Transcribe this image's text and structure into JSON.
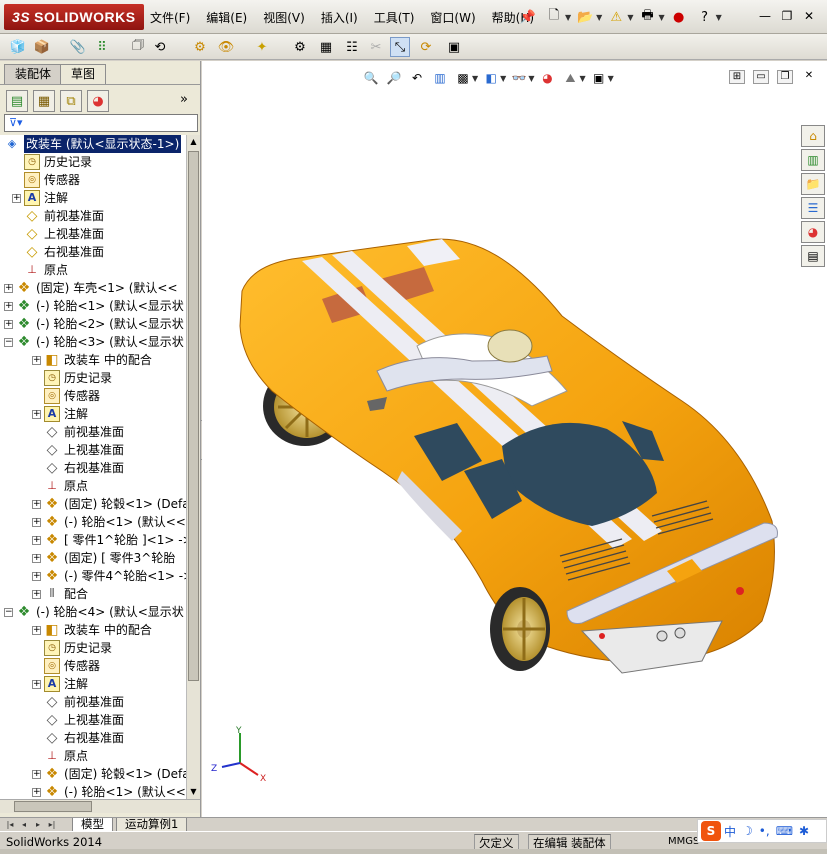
{
  "app": {
    "brand": "SOLIDWORKS",
    "brand_prefix": "3S"
  },
  "menu": [
    "文件(F)",
    "编辑(E)",
    "视图(V)",
    "插入(I)",
    "工具(T)",
    "窗口(W)",
    "帮助(H)"
  ],
  "panel_tabs": {
    "assembly": "装配体",
    "sketch": "草图"
  },
  "filter_icon": "filter-icon",
  "tree": {
    "root": "改装车  (默认<显示状态-1>)",
    "items": [
      {
        "label": "历史记录",
        "icon": "history-icon"
      },
      {
        "label": "传感器",
        "icon": "sensor-icon"
      },
      {
        "label": "注解",
        "icon": "annotation-icon"
      },
      {
        "label": "前视基准面",
        "icon": "plane-icon"
      },
      {
        "label": "上视基准面",
        "icon": "plane-icon"
      },
      {
        "label": "右视基准面",
        "icon": "plane-icon"
      },
      {
        "label": "原点",
        "icon": "origin-icon"
      },
      {
        "label": "(固定) 车壳<1> (默认<<",
        "icon": "component-icon"
      },
      {
        "label": "(-) 轮胎<1> (默认<显示状",
        "icon": "subassembly-icon"
      },
      {
        "label": "(-) 轮胎<2> (默认<显示状",
        "icon": "subassembly-icon"
      },
      {
        "label": "(-) 轮胎<3> (默认<显示状",
        "icon": "subassembly-icon"
      },
      {
        "label": "改装车 中的配合",
        "icon": "mates-icon"
      },
      {
        "label": "历史记录",
        "icon": "history-icon"
      },
      {
        "label": "传感器",
        "icon": "sensor-icon"
      },
      {
        "label": "注解",
        "icon": "annotation-icon"
      },
      {
        "label": "前视基准面",
        "icon": "plane-icon"
      },
      {
        "label": "上视基准面",
        "icon": "plane-icon"
      },
      {
        "label": "右视基准面",
        "icon": "plane-icon"
      },
      {
        "label": "原点",
        "icon": "origin-icon"
      },
      {
        "label": "(固定) 轮毂<1> (Defa",
        "icon": "component-icon"
      },
      {
        "label": "(-) 轮胎<1> (默认<<",
        "icon": "component-icon"
      },
      {
        "label": "[ 零件1^轮胎 ]<1> ->",
        "icon": "component-icon"
      },
      {
        "label": "(固定) [ 零件3^轮胎",
        "icon": "component-icon"
      },
      {
        "label": "(-) 零件4^轮胎<1> ->",
        "icon": "component-icon"
      },
      {
        "label": "配合",
        "icon": "mate-folder-icon"
      },
      {
        "label": "(-) 轮胎<4> (默认<显示状",
        "icon": "subassembly-icon"
      },
      {
        "label": "改装车 中的配合",
        "icon": "mates-icon"
      },
      {
        "label": "历史记录",
        "icon": "history-icon"
      },
      {
        "label": "传感器",
        "icon": "sensor-icon"
      },
      {
        "label": "注解",
        "icon": "annotation-icon"
      },
      {
        "label": "前视基准面",
        "icon": "plane-icon"
      },
      {
        "label": "上视基准面",
        "icon": "plane-icon"
      },
      {
        "label": "右视基准面",
        "icon": "plane-icon"
      },
      {
        "label": "原点",
        "icon": "origin-icon"
      },
      {
        "label": "(固定) 轮毂<1> (Defa",
        "icon": "component-icon"
      },
      {
        "label": "(-) 轮胎<1> (默认<<",
        "icon": "component-icon"
      }
    ]
  },
  "triad": {
    "x": "X",
    "y": "Y",
    "z": "Z"
  },
  "bottom_tabs": {
    "model": "模型",
    "motion": "运动算例1"
  },
  "status": {
    "app_version": "SolidWorks 2014",
    "underdefined": "欠定义",
    "editing": "在编辑 装配体",
    "units": "MMGS"
  },
  "ime": {
    "zh": "中"
  },
  "colors": {
    "car_body": "#f5a30f",
    "stripe": "#e8e8f0",
    "glass": "#2f4a5e",
    "title_red": "#b01e18",
    "selection": "#0a246a"
  }
}
